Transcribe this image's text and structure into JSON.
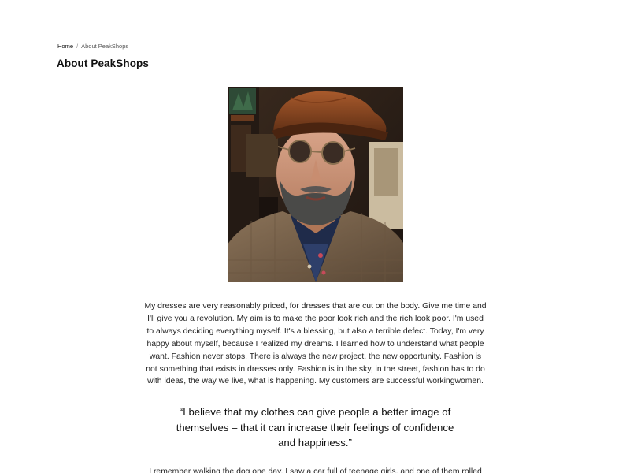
{
  "breadcrumb": {
    "home": "Home",
    "separator": "/",
    "current": "About PeakShops"
  },
  "page": {
    "title": "About PeakShops"
  },
  "content": {
    "paragraph_1": "My dresses are very reasonably priced, for dresses that are cut on the body. Give me time and I'll give you a revolution. My aim is to make the poor look rich and the rich look poor. I'm used to always deciding everything myself. It's a blessing, but also a terrible defect. Today, I'm very happy about myself, because I realized my dreams. I learned how to understand what people want. Fashion never stops. There is always the new project, the new opportunity. Fashion is not something that exists in dresses only. Fashion is in the sky, in the street, fashion has to do with ideas, the way we live, what is happening. My customers are successful workingwomen.",
    "quote": "“I believe that my clothes can give people a better image of themselves – that it can increase their feelings of confidence and happiness.”",
    "paragraph_2": "I remember walking the dog one day. I saw a car full of teenage girls, and one of them rolled"
  }
}
